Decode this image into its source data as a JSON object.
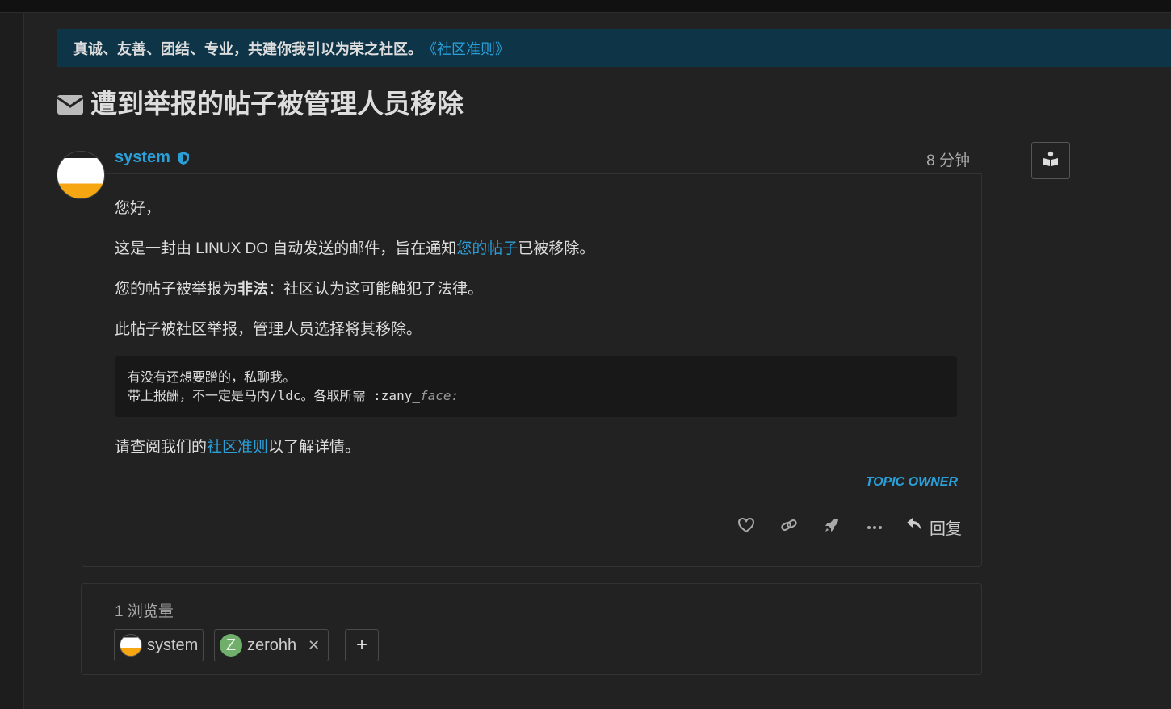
{
  "banner": {
    "text": "真诚、友善、团结、专业，共建你我引以为荣之社区。",
    "link": "《社区准则》"
  },
  "topic": {
    "title": "遭到举报的帖子被管理人员移除"
  },
  "post": {
    "author": "system",
    "date": "8 分钟",
    "greeting": "您好，",
    "line1_pre": "这是一封由 LINUX DO 自动发送的邮件，旨在通知",
    "line1_link": "您的帖子",
    "line1_post": "已被移除。",
    "line2_pre": "您的帖子被举报为",
    "line2_bold": "非法",
    "line2_post": "：社区认为这可能触犯了法律。",
    "line3": "此帖子被社区举报，管理人员选择将其移除。",
    "quote_line1": "有没有还想要蹭的，私聊我。",
    "quote_line2_pre": "带上报酬，不一定是马内/ldc。各取所需 :zany_",
    "quote_line2_em": "face:",
    "line4_pre": "请查阅我们的",
    "line4_link": "社区准则",
    "line4_post": "以了解详情。",
    "owner_tag": "TOPIC OWNER",
    "reply_label": "回复"
  },
  "views": {
    "count_label": "1 浏览量",
    "users": [
      {
        "name": "system"
      },
      {
        "name": "zerohh",
        "initial": "Z"
      }
    ]
  },
  "colors": {
    "accent": "#2a9fd8",
    "banner_bg": "#0d3447",
    "page_bg": "#222222",
    "avatar_orange": "#f5a611"
  }
}
